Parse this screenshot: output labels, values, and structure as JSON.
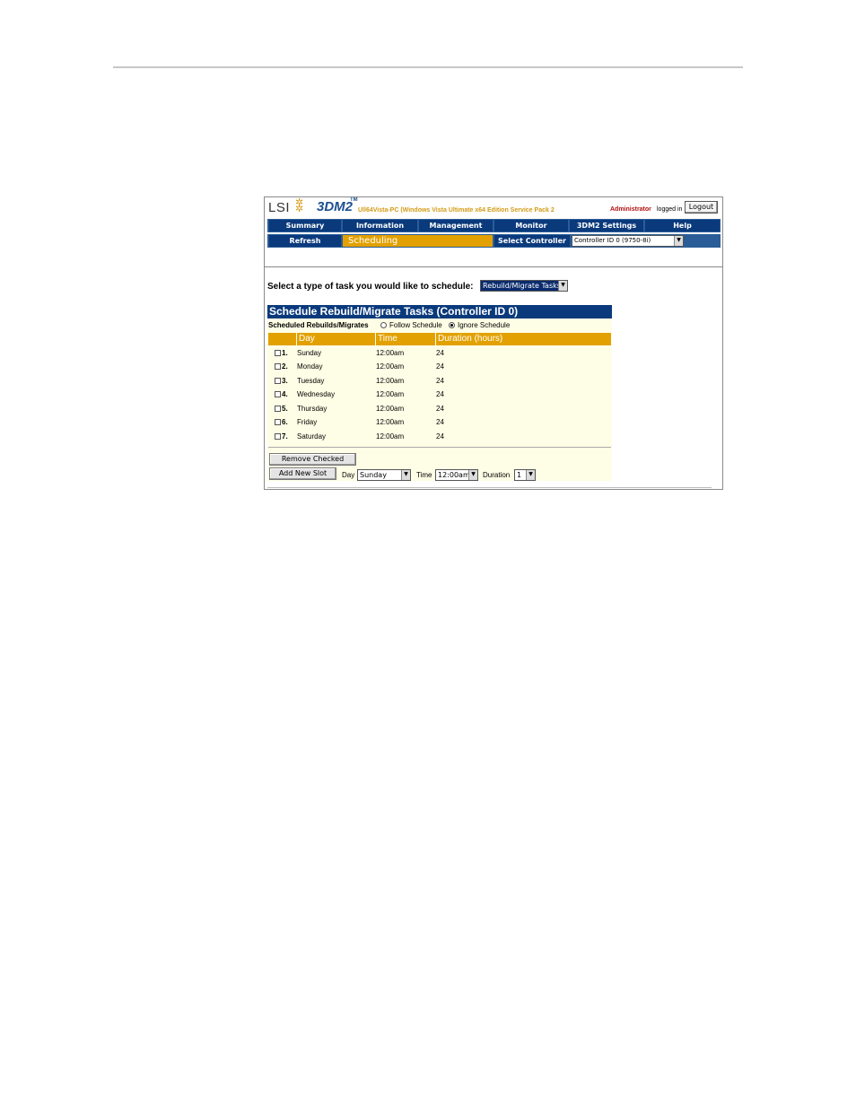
{
  "header": {
    "brand": "LSI",
    "product": "3DM2",
    "trademark": "TM",
    "host_line": "Ull64Vista-PC (Windows Vista Ultimate x64 Edition Service Pack 2",
    "user": "Administrator",
    "logged_in": "logged in",
    "logout_label": "Logout"
  },
  "nav": {
    "row1": [
      "Summary",
      "Information",
      "Management",
      "Monitor",
      "3DM2 Settings",
      "Help"
    ],
    "refresh": "Refresh",
    "active_tab": "Scheduling",
    "select_controller_label": "Select Controller",
    "controller_value": "Controller ID 0 (9750-8i)"
  },
  "task": {
    "prompt": "Select a type of task you would like to schedule:",
    "type_value": "Rebuild/Migrate Tasks"
  },
  "schedule": {
    "title": "Schedule Rebuild/Migrate Tasks (Controller ID 0)",
    "label": "Scheduled Rebuilds/Migrates",
    "option_follow": "Follow Schedule",
    "option_ignore": "Ignore Schedule",
    "selected_option": "Ignore Schedule",
    "columns": [
      "Day",
      "Time",
      "Duration (hours)"
    ],
    "rows": [
      {
        "num": "1.",
        "day": "Sunday",
        "time": "12:00am",
        "duration": "24"
      },
      {
        "num": "2.",
        "day": "Monday",
        "time": "12:00am",
        "duration": "24"
      },
      {
        "num": "3.",
        "day": "Tuesday",
        "time": "12:00am",
        "duration": "24"
      },
      {
        "num": "4.",
        "day": "Wednesday",
        "time": "12:00am",
        "duration": "24"
      },
      {
        "num": "5.",
        "day": "Thursday",
        "time": "12:00am",
        "duration": "24"
      },
      {
        "num": "6.",
        "day": "Friday",
        "time": "12:00am",
        "duration": "24"
      },
      {
        "num": "7.",
        "day": "Saturday",
        "time": "12:00am",
        "duration": "24"
      }
    ],
    "remove_label": "Remove Checked",
    "add_label": "Add New Slot",
    "day_label": "Day",
    "day_value": "Sunday",
    "time_label": "Time",
    "time_value": "12:00am",
    "duration_label": "Duration",
    "duration_value": "1"
  },
  "colors": {
    "nav_blue": "#0a3a7c",
    "accent_gold": "#e2a100",
    "panel_bg": "#fefee6"
  }
}
